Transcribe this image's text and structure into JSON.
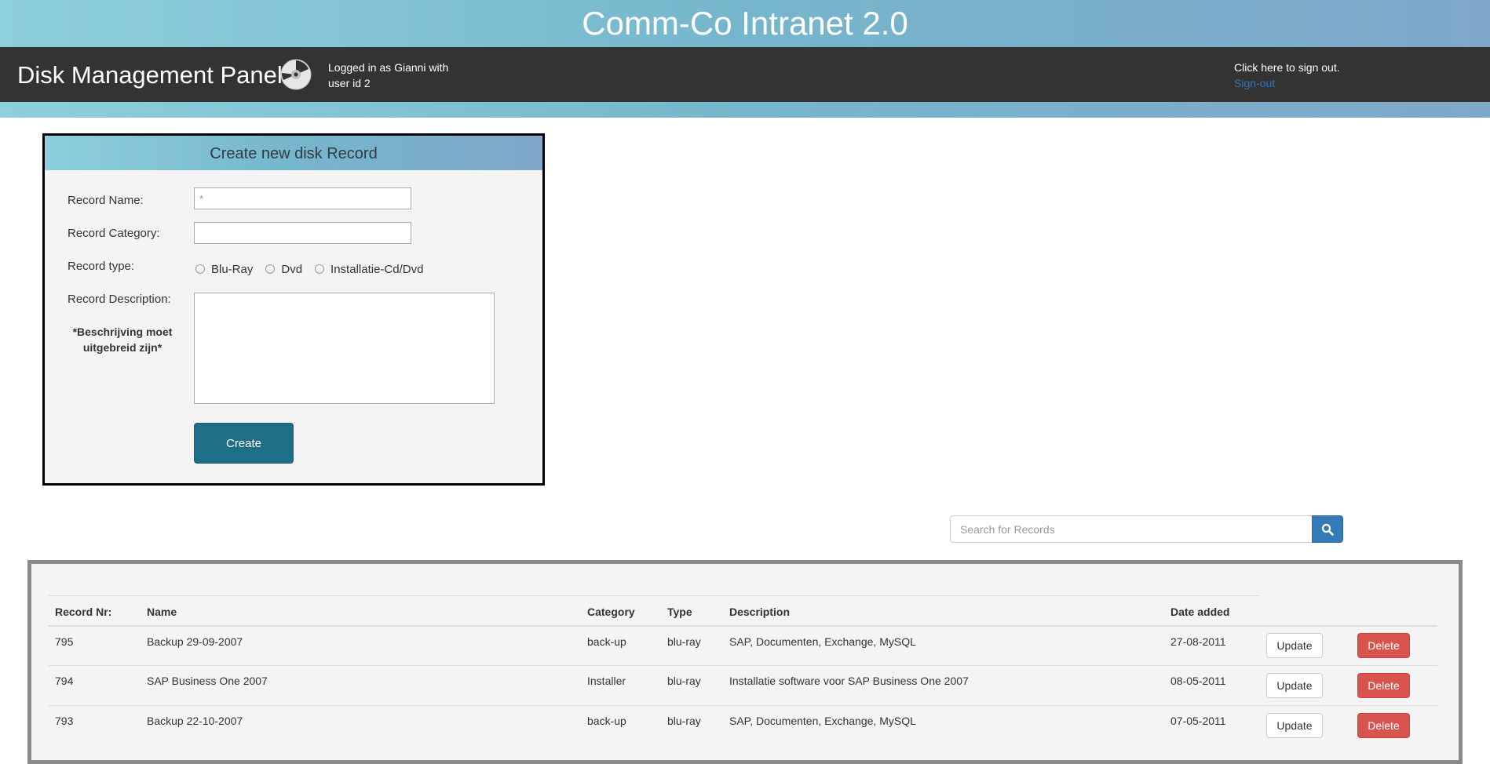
{
  "banner": {
    "title": "Comm-Co Intranet 2.0"
  },
  "navbar": {
    "brand": "Disk Management Panel",
    "brand_icon": "disk-icon",
    "login_info": "Logged in as Gianni with user id 2",
    "signout_text": "Click here to sign out.",
    "signout_link": "Sign-out",
    "link_color": "#337ab7"
  },
  "form": {
    "header": "Create new disk Record",
    "name_label": "Record Name:",
    "name_placeholder": "*",
    "category_label": "Record Category:",
    "type_label": "Record type:",
    "type_options": [
      "Blu-Ray",
      "Dvd",
      "Installatie-Cd/Dvd"
    ],
    "description_label": "Record Description:",
    "note": "*Beschrijving moet uitgebreid zijn*",
    "create_label": "Create",
    "create_color": "#1f6e87"
  },
  "search": {
    "placeholder": "Search for Records",
    "icon": "search-icon",
    "button_color": "#337ab7"
  },
  "table": {
    "headers": [
      "Record Nr:",
      "Name",
      "Category",
      "Type",
      "Description",
      "Date added"
    ],
    "update_label": "Update",
    "delete_label": "Delete",
    "delete_color": "#d9534f",
    "rows": [
      {
        "nr": "795",
        "name": "Backup 29-09-2007",
        "category": "back-up",
        "type": "blu-ray",
        "description": "SAP, Documenten, Exchange, MySQL",
        "date": "27-08-2011"
      },
      {
        "nr": "794",
        "name": "SAP Business One 2007",
        "category": "Installer",
        "type": "blu-ray",
        "description": "Installatie software voor SAP Business One 2007",
        "date": "08-05-2011"
      },
      {
        "nr": "793",
        "name": "Backup 22-10-2007",
        "category": "back-up",
        "type": "blu-ray",
        "description": "SAP, Documenten, Exchange, MySQL",
        "date": "07-05-2011"
      }
    ]
  }
}
